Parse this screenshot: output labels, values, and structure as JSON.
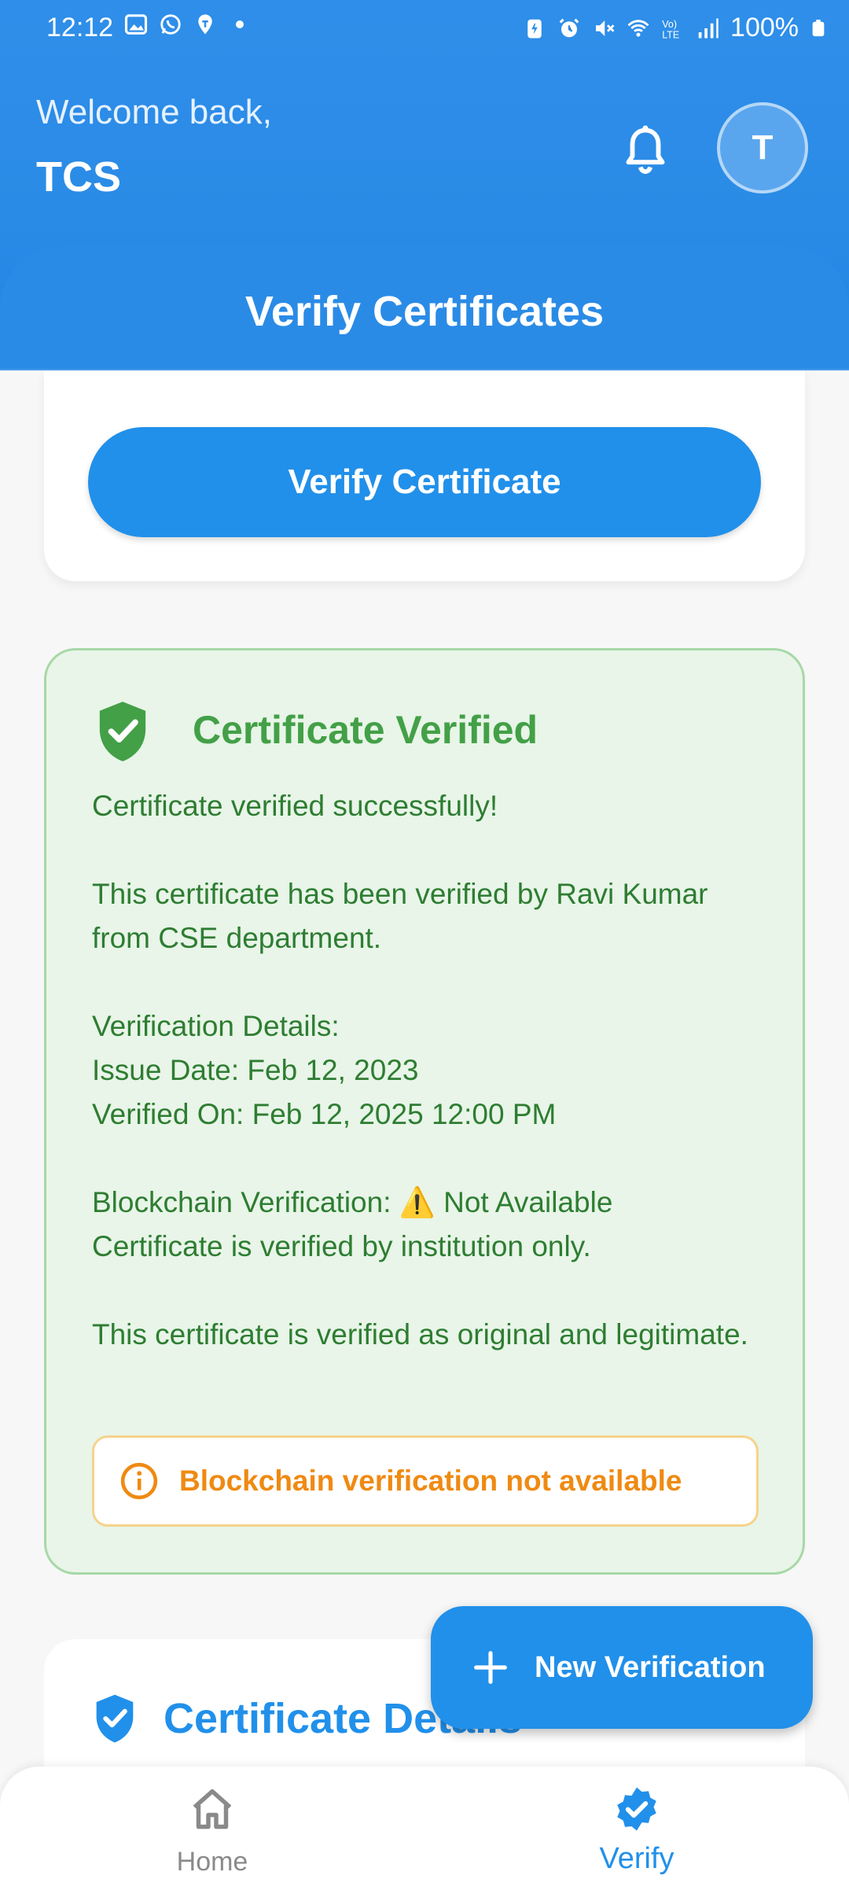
{
  "status_bar": {
    "time": "12:12",
    "battery": "100%"
  },
  "header": {
    "welcome": "Welcome back,",
    "username": "TCS",
    "avatar_initial": "T"
  },
  "section_title": "Verify Certificates",
  "verify_button": "Verify Certificate",
  "result": {
    "title": "Certificate Verified",
    "body": "Certificate verified successfully!\n\nThis certificate has been verified by Ravi Kumar from CSE department.\n\nVerification Details:\nIssue Date: Feb 12, 2023\nVerified On: Feb 12, 2025 12:00 PM\n\nBlockchain Verification: ⚠️ Not Available\nCertificate is verified by institution only.\n\nThis certificate is verified as original and legitimate.",
    "warning": "Blockchain verification not available"
  },
  "details_title": "Certificate Details",
  "fab_label": "New Verification",
  "nav": {
    "home": "Home",
    "verify": "Verify"
  },
  "colors": {
    "primary": "#2190ea",
    "success": "#43a047",
    "warning": "#ef8a12"
  }
}
